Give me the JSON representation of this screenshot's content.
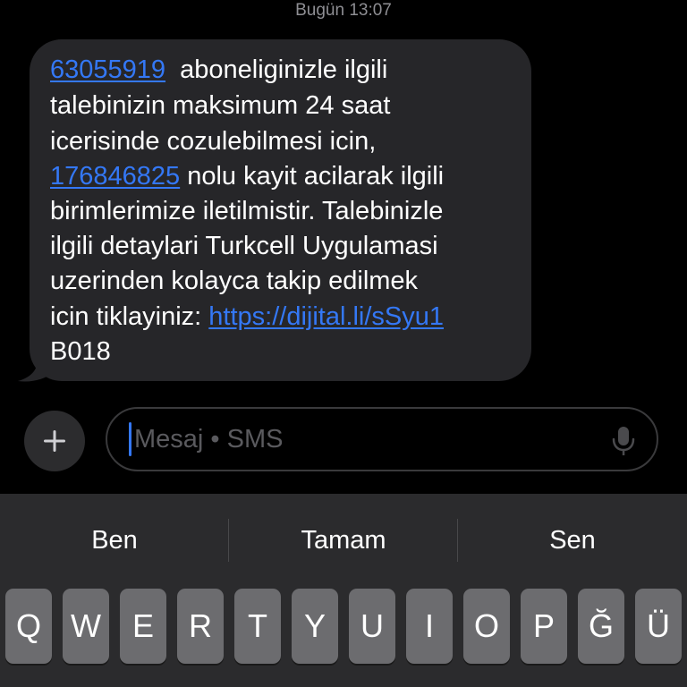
{
  "header": {
    "timestamp": "Bugün 13:07"
  },
  "message": {
    "lines": [
      {
        "link": "63055919",
        "text": "  aboneliginizle ilgili"
      },
      {
        "text": "talebinizin maksimum 24 saat"
      },
      {
        "text": "icerisinde cozulebilmesi icin,"
      },
      {
        "link": "176846825",
        "text": " nolu kayit acilarak ilgili"
      },
      {
        "text": "birimlerimize iletilmistir. Talebinizle"
      },
      {
        "text": "ilgili detaylari Turkcell Uygulamasi"
      },
      {
        "text": "uzerinden kolayca takip edilmek"
      },
      {
        "text": "icin tiklayiniz: ",
        "link": "https://dijital.li/sSyu1"
      },
      {
        "text": "B018"
      }
    ]
  },
  "input": {
    "placeholder": "Mesaj • SMS"
  },
  "keyboard": {
    "suggestions": [
      "Ben",
      "Tamam",
      "Sen"
    ],
    "keys": [
      "Q",
      "W",
      "E",
      "R",
      "T",
      "Y",
      "U",
      "I",
      "O",
      "P",
      "Ğ",
      "Ü"
    ]
  },
  "colors": {
    "link": "#3478f6",
    "bubble": "#262629",
    "keyboard": "#2b2b2d"
  }
}
